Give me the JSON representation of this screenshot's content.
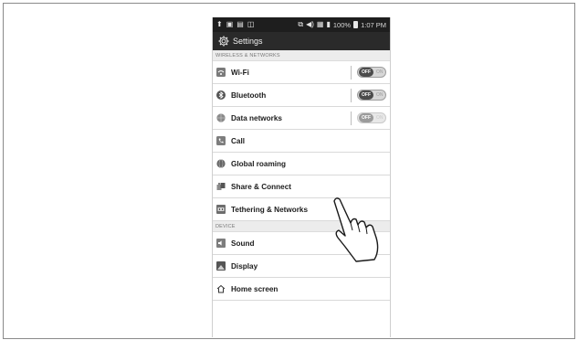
{
  "status_bar": {
    "battery_percent": "100%",
    "time": "1:07 PM",
    "left_icons": [
      "upload-icon",
      "sim-icon",
      "sd-card-icon",
      "message-icon"
    ],
    "right_icons": [
      "nfc-icon",
      "volume-icon",
      "data-icon",
      "signal-icon",
      "battery-icon"
    ]
  },
  "title_bar": {
    "title": "Settings",
    "icon": "gear-icon"
  },
  "sections": {
    "wireless": "WIRELESS & NETWORKS",
    "device": "DEVICE"
  },
  "toggle_labels": {
    "off": "OFF",
    "on": "ON"
  },
  "wireless_items": [
    {
      "label": "Wi-Fi",
      "icon": "wifi-icon",
      "toggle": "off",
      "enabled": true
    },
    {
      "label": "Bluetooth",
      "icon": "bluetooth-icon",
      "toggle": "off",
      "enabled": true
    },
    {
      "label": "Data networks",
      "icon": "globe-icon",
      "toggle": "off",
      "enabled": false
    },
    {
      "label": "Call",
      "icon": "phone-icon"
    },
    {
      "label": "Global roaming",
      "icon": "roaming-icon"
    },
    {
      "label": "Share & Connect",
      "icon": "share-icon"
    },
    {
      "label": "Tethering & Networks",
      "icon": "tethering-icon"
    }
  ],
  "device_items": [
    {
      "label": "Sound",
      "icon": "sound-icon"
    },
    {
      "label": "Display",
      "icon": "display-icon"
    },
    {
      "label": "Home screen",
      "icon": "home-icon"
    }
  ],
  "colors": {
    "status_bar_bg": "#1e1e1e",
    "title_bar_bg": "#2a2a2a",
    "section_bg": "#ececec",
    "divider": "#d9d9d9"
  },
  "overlay": {
    "pointer": "hand-pointer-icon",
    "target": "Share & Connect"
  }
}
